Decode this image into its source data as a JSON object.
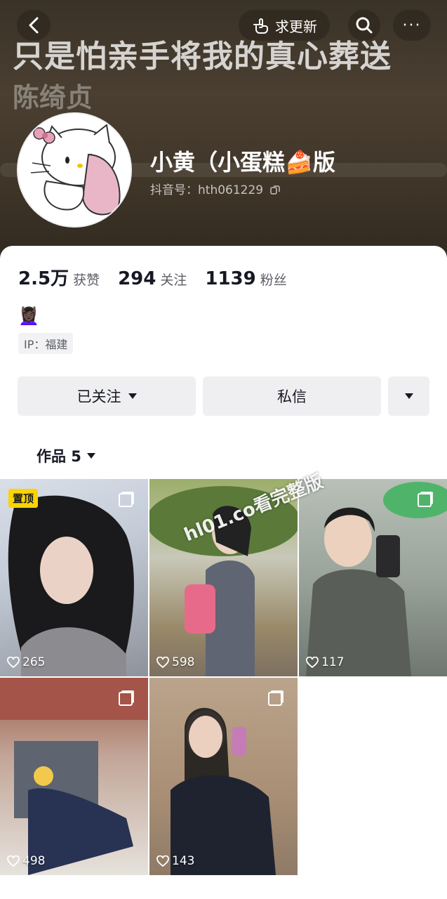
{
  "header": {
    "lyric_line1": "只是怕亲手将我的真心葬送",
    "lyric_line2": "陈绮贞",
    "update_label": "求更新",
    "more_label": "···"
  },
  "profile": {
    "nickname": "小黄（小蛋糕🍰版",
    "douyin_id": "抖音号：hth061229"
  },
  "stats": [
    {
      "num": "2.5万",
      "label": "获赞"
    },
    {
      "num": "294",
      "label": "关注"
    },
    {
      "num": "1139",
      "label": "粉丝"
    }
  ],
  "bio": "💆🏿‍♀️",
  "ip": "IP：福建",
  "actions": {
    "followed_label": "已关注",
    "message_label": "私信"
  },
  "works_tab": {
    "label": "作品 5"
  },
  "videos": [
    {
      "likes": "265",
      "pinned": "置顶"
    },
    {
      "likes": "598"
    },
    {
      "likes": "117"
    },
    {
      "likes": "498"
    },
    {
      "likes": "143"
    }
  ],
  "watermark": "hl01.co看完整版",
  "colors": {
    "pin_badge": "#fad400",
    "button_bg": "#efeff1",
    "text_primary": "#161823"
  }
}
